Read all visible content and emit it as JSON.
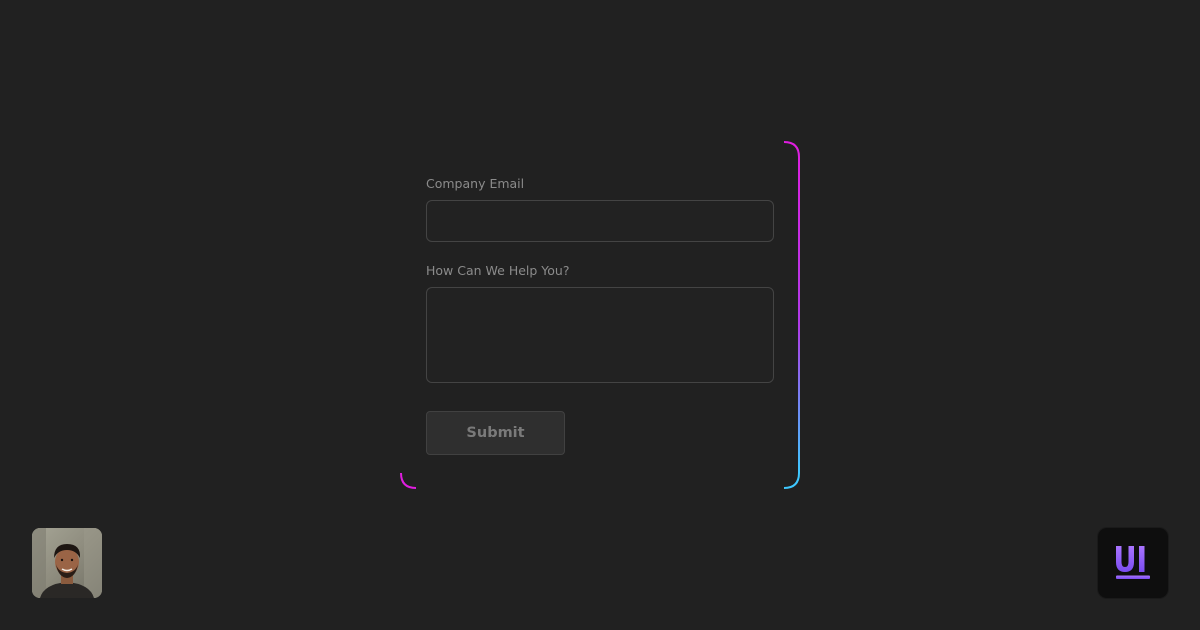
{
  "form": {
    "email_label": "Company Email",
    "email_value": "",
    "message_label": "How Can We Help You?",
    "message_value": "",
    "submit_label": "Submit"
  },
  "colors": {
    "background": "#212121",
    "border_gradient_start": "#e01ee0",
    "border_gradient_end": "#3ec8ff",
    "brand_purple": "#8b5cf6"
  },
  "icons": {
    "avatar": "user-avatar-photo",
    "brand": "ui-logo-icon"
  }
}
